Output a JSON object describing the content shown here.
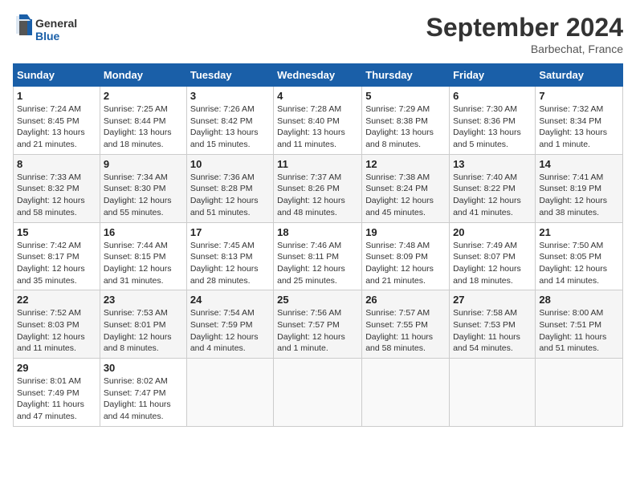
{
  "header": {
    "logo_line1": "General",
    "logo_line2": "Blue",
    "month_title": "September 2024",
    "subtitle": "Barbechat, France"
  },
  "weekdays": [
    "Sunday",
    "Monday",
    "Tuesday",
    "Wednesday",
    "Thursday",
    "Friday",
    "Saturday"
  ],
  "weeks": [
    [
      {
        "day": "1",
        "detail": "Sunrise: 7:24 AM\nSunset: 8:45 PM\nDaylight: 13 hours\nand 21 minutes."
      },
      {
        "day": "2",
        "detail": "Sunrise: 7:25 AM\nSunset: 8:44 PM\nDaylight: 13 hours\nand 18 minutes."
      },
      {
        "day": "3",
        "detail": "Sunrise: 7:26 AM\nSunset: 8:42 PM\nDaylight: 13 hours\nand 15 minutes."
      },
      {
        "day": "4",
        "detail": "Sunrise: 7:28 AM\nSunset: 8:40 PM\nDaylight: 13 hours\nand 11 minutes."
      },
      {
        "day": "5",
        "detail": "Sunrise: 7:29 AM\nSunset: 8:38 PM\nDaylight: 13 hours\nand 8 minutes."
      },
      {
        "day": "6",
        "detail": "Sunrise: 7:30 AM\nSunset: 8:36 PM\nDaylight: 13 hours\nand 5 minutes."
      },
      {
        "day": "7",
        "detail": "Sunrise: 7:32 AM\nSunset: 8:34 PM\nDaylight: 13 hours\nand 1 minute."
      }
    ],
    [
      {
        "day": "8",
        "detail": "Sunrise: 7:33 AM\nSunset: 8:32 PM\nDaylight: 12 hours\nand 58 minutes."
      },
      {
        "day": "9",
        "detail": "Sunrise: 7:34 AM\nSunset: 8:30 PM\nDaylight: 12 hours\nand 55 minutes."
      },
      {
        "day": "10",
        "detail": "Sunrise: 7:36 AM\nSunset: 8:28 PM\nDaylight: 12 hours\nand 51 minutes."
      },
      {
        "day": "11",
        "detail": "Sunrise: 7:37 AM\nSunset: 8:26 PM\nDaylight: 12 hours\nand 48 minutes."
      },
      {
        "day": "12",
        "detail": "Sunrise: 7:38 AM\nSunset: 8:24 PM\nDaylight: 12 hours\nand 45 minutes."
      },
      {
        "day": "13",
        "detail": "Sunrise: 7:40 AM\nSunset: 8:22 PM\nDaylight: 12 hours\nand 41 minutes."
      },
      {
        "day": "14",
        "detail": "Sunrise: 7:41 AM\nSunset: 8:19 PM\nDaylight: 12 hours\nand 38 minutes."
      }
    ],
    [
      {
        "day": "15",
        "detail": "Sunrise: 7:42 AM\nSunset: 8:17 PM\nDaylight: 12 hours\nand 35 minutes."
      },
      {
        "day": "16",
        "detail": "Sunrise: 7:44 AM\nSunset: 8:15 PM\nDaylight: 12 hours\nand 31 minutes."
      },
      {
        "day": "17",
        "detail": "Sunrise: 7:45 AM\nSunset: 8:13 PM\nDaylight: 12 hours\nand 28 minutes."
      },
      {
        "day": "18",
        "detail": "Sunrise: 7:46 AM\nSunset: 8:11 PM\nDaylight: 12 hours\nand 25 minutes."
      },
      {
        "day": "19",
        "detail": "Sunrise: 7:48 AM\nSunset: 8:09 PM\nDaylight: 12 hours\nand 21 minutes."
      },
      {
        "day": "20",
        "detail": "Sunrise: 7:49 AM\nSunset: 8:07 PM\nDaylight: 12 hours\nand 18 minutes."
      },
      {
        "day": "21",
        "detail": "Sunrise: 7:50 AM\nSunset: 8:05 PM\nDaylight: 12 hours\nand 14 minutes."
      }
    ],
    [
      {
        "day": "22",
        "detail": "Sunrise: 7:52 AM\nSunset: 8:03 PM\nDaylight: 12 hours\nand 11 minutes."
      },
      {
        "day": "23",
        "detail": "Sunrise: 7:53 AM\nSunset: 8:01 PM\nDaylight: 12 hours\nand 8 minutes."
      },
      {
        "day": "24",
        "detail": "Sunrise: 7:54 AM\nSunset: 7:59 PM\nDaylight: 12 hours\nand 4 minutes."
      },
      {
        "day": "25",
        "detail": "Sunrise: 7:56 AM\nSunset: 7:57 PM\nDaylight: 12 hours\nand 1 minute."
      },
      {
        "day": "26",
        "detail": "Sunrise: 7:57 AM\nSunset: 7:55 PM\nDaylight: 11 hours\nand 58 minutes."
      },
      {
        "day": "27",
        "detail": "Sunrise: 7:58 AM\nSunset: 7:53 PM\nDaylight: 11 hours\nand 54 minutes."
      },
      {
        "day": "28",
        "detail": "Sunrise: 8:00 AM\nSunset: 7:51 PM\nDaylight: 11 hours\nand 51 minutes."
      }
    ],
    [
      {
        "day": "29",
        "detail": "Sunrise: 8:01 AM\nSunset: 7:49 PM\nDaylight: 11 hours\nand 47 minutes."
      },
      {
        "day": "30",
        "detail": "Sunrise: 8:02 AM\nSunset: 7:47 PM\nDaylight: 11 hours\nand 44 minutes."
      },
      {
        "day": "",
        "detail": ""
      },
      {
        "day": "",
        "detail": ""
      },
      {
        "day": "",
        "detail": ""
      },
      {
        "day": "",
        "detail": ""
      },
      {
        "day": "",
        "detail": ""
      }
    ]
  ]
}
